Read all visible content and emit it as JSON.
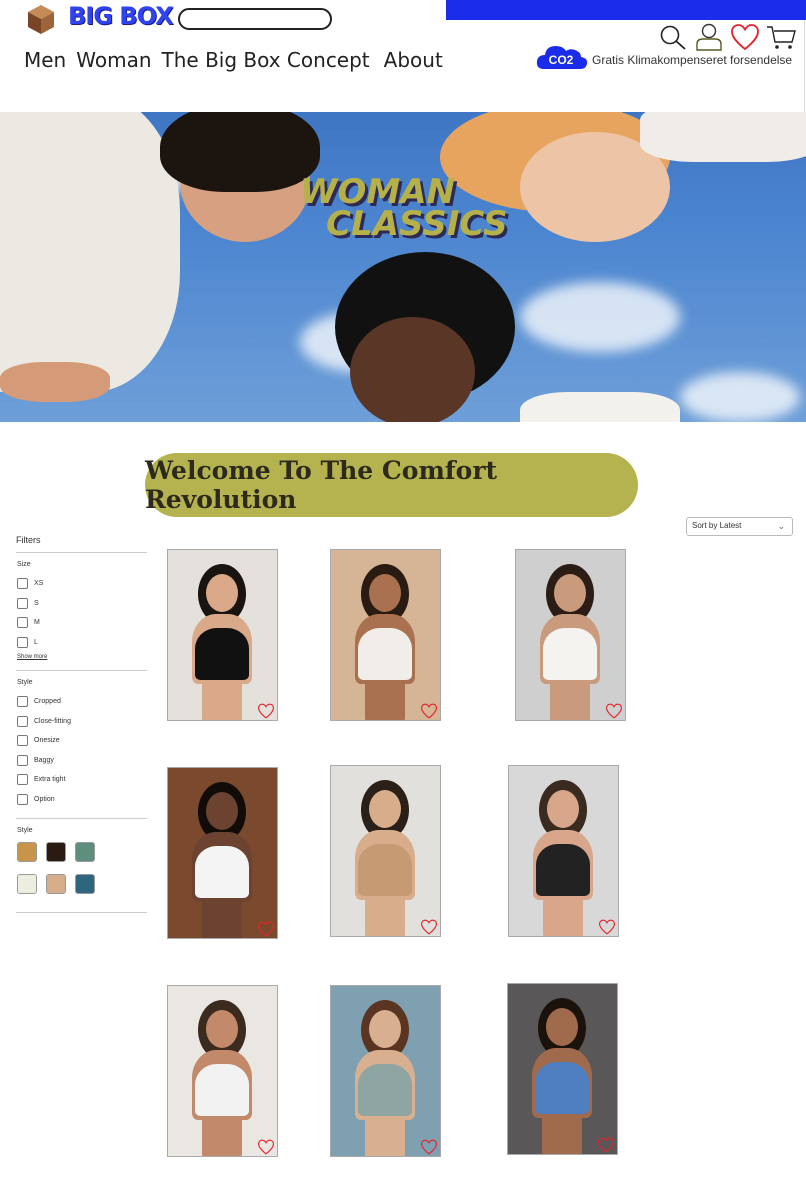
{
  "header": {
    "brand": "BIG BOX",
    "search": {
      "value": "",
      "placeholder": ""
    },
    "nav": [
      "Men",
      "Woman",
      "The Big Box Concept",
      "About"
    ],
    "icons": [
      "search-icon",
      "user-icon",
      "heart-icon",
      "cart-icon"
    ],
    "co2_badge": "CO2",
    "shipping_text": "Gratis Klimakompenseret forsendelse",
    "accent": "#1b2bea"
  },
  "hero": {
    "title_line1": "WOMAN",
    "title_line2": "CLASSICS"
  },
  "welcome": "Welcome To The Comfort Revolution",
  "sort": {
    "selected": "Sort by Latest"
  },
  "filters": {
    "heading": "Filters",
    "size_title": "Size",
    "sizes": [
      "XS",
      "S",
      "M",
      "L"
    ],
    "show_more": "Show more",
    "style_title": "Style",
    "styles": [
      "Cropped",
      "Close-fitting",
      "Onesize",
      "Baggy",
      "Extra tight",
      "Option"
    ],
    "color_title": "Style",
    "colors": [
      "#c8944a",
      "#2a1a10",
      "#5e8f7c",
      "#eeeee0",
      "#d7ad8a",
      "#2e6680"
    ]
  },
  "products": [
    {
      "bg": "#e4e1dd",
      "skin": "#d9a98a",
      "garment": "#111111",
      "hair": "#1a1410"
    },
    {
      "bg": "#d6b496",
      "skin": "#a9714f",
      "garment": "#f1ede8",
      "hair": "#2a1b12"
    },
    {
      "bg": "#cfcfcf",
      "skin": "#c99a7c",
      "garment": "#f5f3f0",
      "hair": "#2b1d15"
    },
    {
      "bg": "#7b4a2e",
      "skin": "#6b4330",
      "garment": "#f4f4f4",
      "hair": "#120c08"
    },
    {
      "bg": "#e1e0dc",
      "skin": "#d7ad8c",
      "garment": "#c69a73",
      "hair": "#2b2018"
    },
    {
      "bg": "#d8d8d8",
      "skin": "#d8a78b",
      "garment": "#222222",
      "hair": "#3a2a1f"
    },
    {
      "bg": "#eae7e2",
      "skin": "#c2896a",
      "garment": "#f2f2f2",
      "hair": "#3b2a1e"
    },
    {
      "bg": "#7fa0b0",
      "skin": "#d8b090",
      "garment": "#8fa5a2",
      "hair": "#5a3522"
    },
    {
      "bg": "#595757",
      "skin": "#a06b4d",
      "garment": "#4f7fc0",
      "hair": "#1b120c"
    }
  ]
}
